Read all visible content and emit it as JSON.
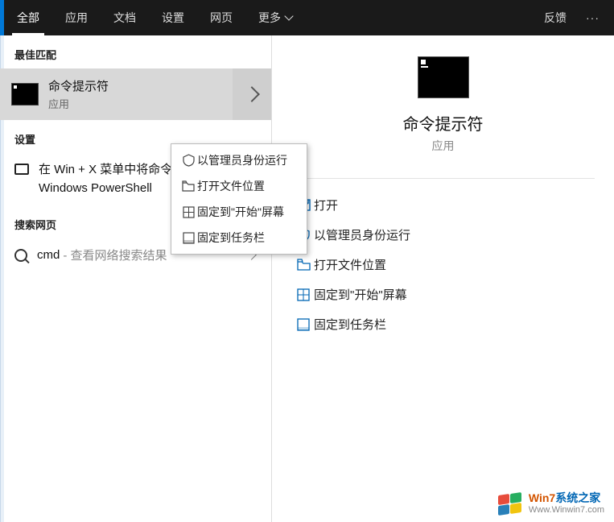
{
  "topbar": {
    "tabs": [
      {
        "label": "全部",
        "active": true
      },
      {
        "label": "应用"
      },
      {
        "label": "文档"
      },
      {
        "label": "设置"
      },
      {
        "label": "网页"
      },
      {
        "label": "更多"
      }
    ],
    "feedback": "反馈",
    "more": "···"
  },
  "left": {
    "best_match_label": "最佳匹配",
    "best_item": {
      "title": "命令提示符",
      "subtitle": "应用"
    },
    "settings_label": "设置",
    "settings_item": "在 Win + X 菜单中将命令提示符替换为 Windows PowerShell",
    "web_label": "搜索网页",
    "web_item": {
      "query": "cmd",
      "hint": "- 查看网络搜索结果"
    }
  },
  "context_menu": [
    {
      "icon": "shield",
      "label": "以管理员身份运行"
    },
    {
      "icon": "folder",
      "label": "打开文件位置"
    },
    {
      "icon": "pin",
      "label": "固定到\"开始\"屏幕"
    },
    {
      "icon": "taskbar",
      "label": "固定到任务栏"
    }
  ],
  "right": {
    "title": "命令提示符",
    "type": "应用",
    "actions": [
      {
        "icon": "open",
        "label": "打开"
      },
      {
        "icon": "shield",
        "label": "以管理员身份运行"
      },
      {
        "icon": "folder",
        "label": "打开文件位置"
      },
      {
        "icon": "pin",
        "label": "固定到\"开始\"屏幕"
      },
      {
        "icon": "taskbar",
        "label": "固定到任务栏"
      }
    ]
  },
  "watermark": {
    "line1_brand": "Win7",
    "line1_rest": "系统之家",
    "line2": "Www.Winwin7.com"
  }
}
